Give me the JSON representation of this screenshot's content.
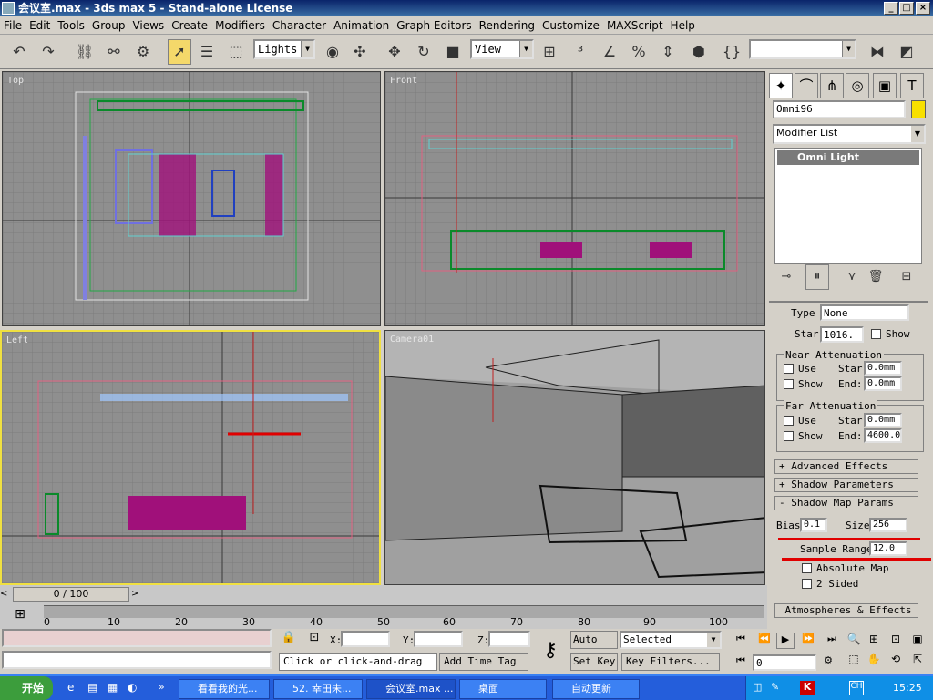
{
  "window": {
    "title": "会议室.max - 3ds max 5 - Stand-alone License"
  },
  "menu": [
    "File",
    "Edit",
    "Tools",
    "Group",
    "Views",
    "Create",
    "Modifiers",
    "Character",
    "Animation",
    "Graph Editors",
    "Rendering",
    "Customize",
    "MAXScript",
    "Help"
  ],
  "toolbar": {
    "selection_filter": "Lights",
    "ref_coord": "View"
  },
  "viewports": {
    "top": "Top",
    "front": "Front",
    "left": "Left",
    "camera": "Camera01"
  },
  "cmd": {
    "object_name": "Omni96",
    "modifier_list": "Modifier List",
    "stack_item": "Omni Light",
    "type_label": "Type",
    "type_value": "None",
    "start_label": "Star",
    "start_value": "1016.",
    "show_label": "Show",
    "near_title": "Near Attenuation",
    "near_use": "Use",
    "near_show": "Show",
    "near_start_label": "Star",
    "near_start": "0.0mm",
    "near_end_label": "End:",
    "near_end": "0.0mm",
    "far_title": "Far Attenuation",
    "far_use": "Use",
    "far_show": "Show",
    "far_start_label": "Star",
    "far_start": "0.0mm",
    "far_end_label": "End:",
    "far_end": "4600.0",
    "rollout_adv": "+  Advanced Effects",
    "rollout_shadow": "+  Shadow Parameters",
    "rollout_shadowmap": "-  Shadow Map Params",
    "bias_label": "Bias:",
    "bias": "0.1",
    "size_label": "Size:",
    "size": "256",
    "sample_label": "Sample Range:",
    "sample": "12.0",
    "absolute": "Absolute Map",
    "two_sided": "2 Sided",
    "rollout_atmos": "Atmospheres & Effects"
  },
  "timeline": {
    "frame": "0 / 100",
    "ticks": [
      "0",
      "10",
      "20",
      "30",
      "40",
      "50",
      "60",
      "70",
      "80",
      "90",
      "100"
    ]
  },
  "status": {
    "prompt": "Click or click-and-drag",
    "add_tag": "Add Time Tag",
    "x_label": "X:",
    "y_label": "Y:",
    "z_label": "Z:",
    "auto_key": "Auto Key",
    "set_key": "Set Key",
    "key_mode": "Selected",
    "key_filters": "Key Filters...",
    "frame_value": "0"
  },
  "taskbar": {
    "start": "开始",
    "tasks": [
      "看看我的光...",
      "52. 幸田未...",
      "会议室.max ...",
      "桌面",
      "自动更新"
    ],
    "clock": "15:25"
  },
  "colors": {
    "title_bg": "#0a246a",
    "viewport": "#8f8f8f",
    "taskbar": "#245edb",
    "highlight": "#e00000"
  }
}
